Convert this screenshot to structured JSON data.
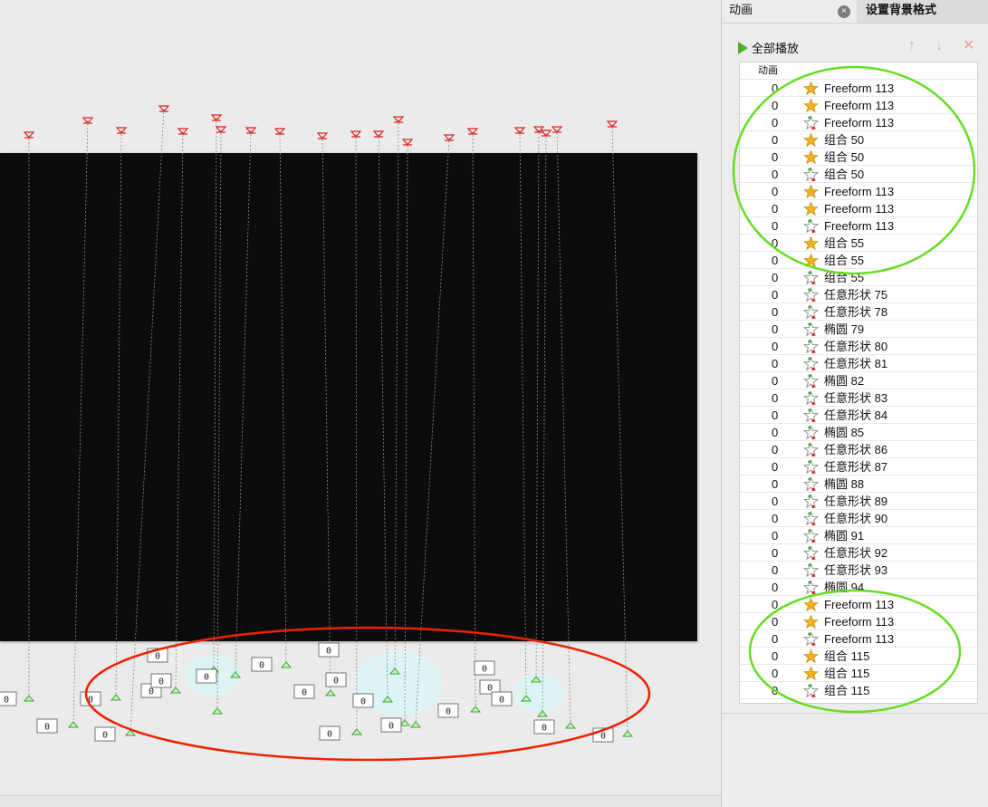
{
  "panel": {
    "tab_animation": "动画",
    "tab_close": "×",
    "tab_background": "设置背景格式",
    "play_all": "全部播放",
    "move_up": "↑",
    "move_down": "↓",
    "delete": "✕",
    "list_header": "动画",
    "items": [
      {
        "num": "0",
        "name": "Freeform 113",
        "icon": "emphasis-star-icon"
      },
      {
        "num": "0",
        "name": "Freeform 113",
        "icon": "emphasis-star-icon"
      },
      {
        "num": "0",
        "name": "Freeform 113",
        "icon": "motion-path-star-icon"
      },
      {
        "num": "0",
        "name": "组合 50",
        "icon": "emphasis-star-icon"
      },
      {
        "num": "0",
        "name": "组合 50",
        "icon": "emphasis-star-icon"
      },
      {
        "num": "0",
        "name": "组合 50",
        "icon": "motion-path-star-icon"
      },
      {
        "num": "0",
        "name": "Freeform 113",
        "icon": "emphasis-star-icon"
      },
      {
        "num": "0",
        "name": "Freeform 113",
        "icon": "emphasis-star-icon"
      },
      {
        "num": "0",
        "name": "Freeform 113",
        "icon": "motion-path-star-icon"
      },
      {
        "num": "0",
        "name": "组合 55",
        "icon": "emphasis-star-icon"
      },
      {
        "num": "0",
        "name": "组合 55",
        "icon": "emphasis-star-icon"
      },
      {
        "num": "0",
        "name": "组合 55",
        "icon": "motion-path-star-icon"
      },
      {
        "num": "0",
        "name": "任意形状 75",
        "icon": "motion-path-star-icon"
      },
      {
        "num": "0",
        "name": "任意形状 78",
        "icon": "motion-path-star-icon"
      },
      {
        "num": "0",
        "name": "椭圆 79",
        "icon": "motion-path-star-icon"
      },
      {
        "num": "0",
        "name": "任意形状 80",
        "icon": "motion-path-star-icon"
      },
      {
        "num": "0",
        "name": "任意形状 81",
        "icon": "motion-path-star-icon"
      },
      {
        "num": "0",
        "name": "椭圆 82",
        "icon": "motion-path-star-icon"
      },
      {
        "num": "0",
        "name": "任意形状 83",
        "icon": "motion-path-star-icon"
      },
      {
        "num": "0",
        "name": "任意形状 84",
        "icon": "motion-path-star-icon"
      },
      {
        "num": "0",
        "name": "椭圆 85",
        "icon": "motion-path-star-icon"
      },
      {
        "num": "0",
        "name": "任意形状 86",
        "icon": "motion-path-star-icon"
      },
      {
        "num": "0",
        "name": "任意形状 87",
        "icon": "motion-path-star-icon"
      },
      {
        "num": "0",
        "name": "椭圆 88",
        "icon": "motion-path-star-icon"
      },
      {
        "num": "0",
        "name": "任意形状 89",
        "icon": "motion-path-star-icon"
      },
      {
        "num": "0",
        "name": "任意形状 90",
        "icon": "motion-path-star-icon"
      },
      {
        "num": "0",
        "name": "椭圆 91",
        "icon": "motion-path-star-icon"
      },
      {
        "num": "0",
        "name": "任意形状 92",
        "icon": "motion-path-star-icon"
      },
      {
        "num": "0",
        "name": "任意形状 93",
        "icon": "motion-path-star-icon"
      },
      {
        "num": "0",
        "name": "椭圆 94",
        "icon": "motion-path-star-icon"
      },
      {
        "num": "0",
        "name": "Freeform 113",
        "icon": "emphasis-star-icon"
      },
      {
        "num": "0",
        "name": "Freeform 113",
        "icon": "emphasis-star-icon"
      },
      {
        "num": "0",
        "name": "Freeform 113",
        "icon": "motion-path-star-icon"
      },
      {
        "num": "0",
        "name": "组合 115",
        "icon": "emphasis-star-icon"
      },
      {
        "num": "0",
        "name": "组合 115",
        "icon": "emphasis-star-icon"
      },
      {
        "num": "0",
        "name": "组合 115",
        "icon": "motion-path-star-icon"
      }
    ]
  },
  "canvas": {
    "order_tag": "0"
  },
  "colors": {
    "accent_green": "#4caf32",
    "annotation_green": "#66dd22",
    "annotation_red": "#ee2200",
    "path_start": "#e02020",
    "path_end": "#3aa83a",
    "star_gold": "#f2b320"
  }
}
